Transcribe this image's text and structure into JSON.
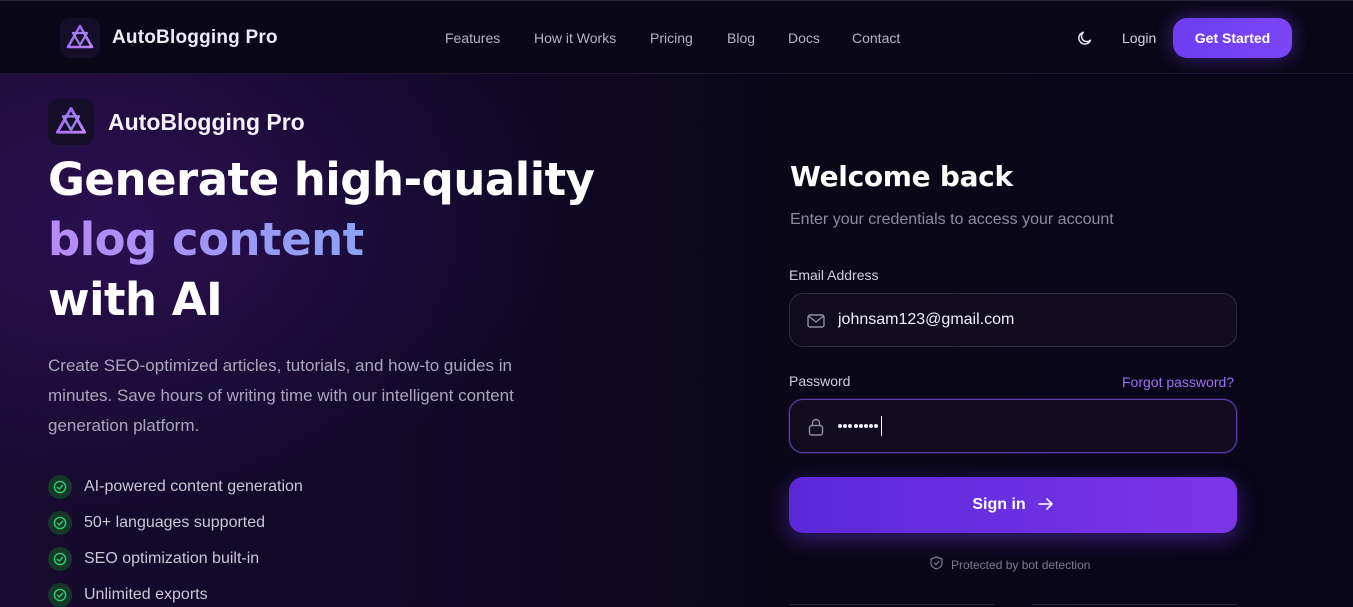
{
  "nav": {
    "brand": "AutoBlogging Pro",
    "links": [
      "Features",
      "How it Works",
      "Pricing",
      "Blog",
      "Docs",
      "Contact"
    ],
    "login": "Login",
    "cta": "Get Started"
  },
  "hero": {
    "brand": "AutoBlogging Pro",
    "headline_line1": "Generate high-quality",
    "headline_line2": "blog content",
    "headline_line3": "with AI",
    "description": "Create SEO-optimized articles, tutorials, and how-to guides in minutes. Save hours of writing time with our intelligent content generation platform.",
    "features": [
      "AI-powered content generation",
      "50+ languages supported",
      "SEO optimization built-in",
      "Unlimited exports"
    ]
  },
  "form": {
    "title": "Welcome back",
    "subtitle": "Enter your credentials to access your account",
    "email_label": "Email Address",
    "email_value": "johnsam123@gmail.com",
    "password_label": "Password",
    "forgot": "Forgot password?",
    "password_masked_length": 8,
    "submit": "Sign in",
    "protected_note": "Protected by bot detection"
  },
  "colors": {
    "accent": "#6d3df2",
    "link_purple": "#9f6ff5",
    "check_green": "#2ecc71",
    "background": "#09061a"
  },
  "icons": {
    "logo": "layered-triangle-logo",
    "theme": "moon-icon",
    "email": "mail-icon",
    "password": "lock-icon",
    "submit": "arrow-right-icon",
    "feature": "check-circle-icon",
    "protected": "shield-icon"
  }
}
